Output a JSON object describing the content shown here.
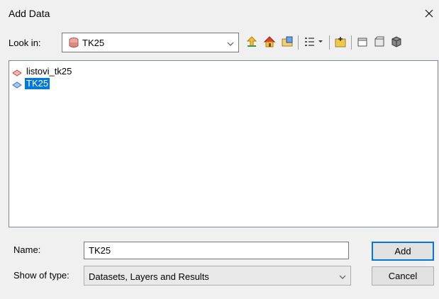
{
  "window": {
    "title": "Add Data",
    "close_icon": "close-icon"
  },
  "lookin": {
    "label": "Look in:",
    "value": "TK25",
    "icon": "raster-dataset-icon"
  },
  "toolbar": {
    "buttons": [
      {
        "name": "up-one-level-icon"
      },
      {
        "name": "home-icon"
      },
      {
        "name": "connect-folder-icon"
      },
      {
        "name": "view-menu-icon"
      },
      {
        "name": "new-folder-icon"
      },
      {
        "name": "catalog-icon"
      },
      {
        "name": "toolbox-icon"
      },
      {
        "name": "database-icon"
      }
    ]
  },
  "files": [
    {
      "label": "listovi_tk25",
      "icon": "polygon-featureclass-icon",
      "selected": false
    },
    {
      "label": "TK25",
      "icon": "raster-icon",
      "selected": true
    }
  ],
  "form": {
    "name_label": "Name:",
    "name_value": "TK25",
    "type_label": "Show of type:",
    "type_value": "Datasets, Layers and Results"
  },
  "buttons": {
    "add": "Add",
    "cancel": "Cancel"
  },
  "colors": {
    "selection": "#0078d7",
    "background": "#f0f0f0"
  }
}
